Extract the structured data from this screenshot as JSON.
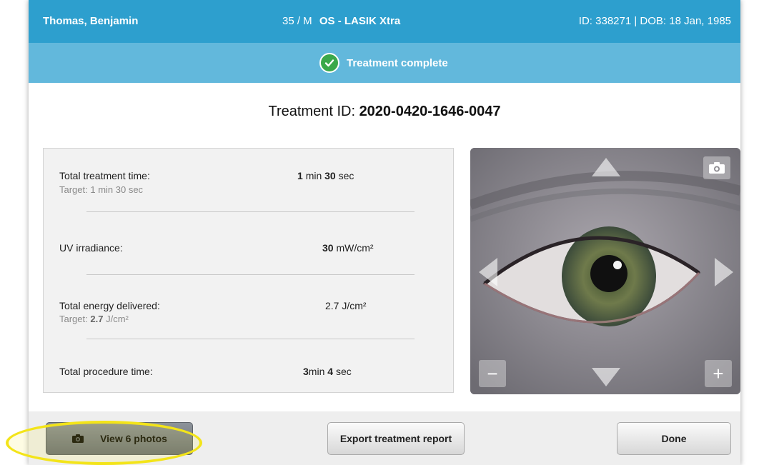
{
  "header": {
    "patient_name": "Thomas, Benjamin",
    "age_sex": "35 / M",
    "procedure": "OS - LASIK Xtra",
    "id_dob": "ID: 338271 | DOB: 18 Jan, 1985"
  },
  "status": {
    "text": "Treatment complete",
    "icon": "checkmark-icon",
    "color": "#3aa84a"
  },
  "treatment": {
    "id_label": "Treatment ID:",
    "id_value": "2020-0420-1646-0047"
  },
  "metrics": {
    "treatment_time": {
      "label": "Total treatment time:",
      "target": "Target: 1 min 30 sec",
      "min_value": "1",
      "min_unit": "min",
      "sec_value": "30",
      "sec_unit": "sec"
    },
    "uv_irradiance": {
      "label": "UV irradiance:",
      "value": "30",
      "unit": "mW/cm²"
    },
    "energy": {
      "label": "Total energy delivered:",
      "target_prefix": "Target:",
      "target_value": "2.7",
      "target_unit": "J/cm²",
      "value": "2.7",
      "unit": "J/cm²"
    },
    "procedure_time": {
      "label": "Total procedure time:",
      "min_value": "3",
      "min_unit": "min",
      "sec_value": "4",
      "sec_unit": "sec"
    }
  },
  "camera": {
    "zoom_out": "−",
    "zoom_in": "+",
    "icons": [
      "arrow-up-icon",
      "arrow-down-icon",
      "arrow-left-icon",
      "arrow-right-icon",
      "camera-icon"
    ]
  },
  "footer": {
    "view_photos": "View 6 photos",
    "export_report": "Export treatment report",
    "done": "Done"
  },
  "colors": {
    "header_bg": "#2d9fce",
    "status_bg": "#62b8dc",
    "highlight": "#f3e419"
  }
}
